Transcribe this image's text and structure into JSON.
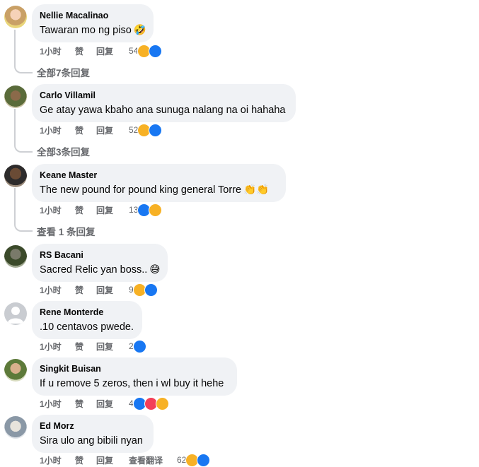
{
  "comments": [
    {
      "name": "Nellie Macalinao",
      "text": "Tawaran mo ng piso",
      "emoji": "🤣",
      "time": "1小时",
      "like": "赞",
      "reply": "回复",
      "count": "54",
      "reactions": [
        "haha",
        "like"
      ],
      "replies": "全部7条回复"
    },
    {
      "name": "Carlo Villamil",
      "text": "Ge atay yawa kbaho ana sunuga nalang na oi hahaha",
      "emoji": "",
      "time": "1小时",
      "like": "赞",
      "reply": "回复",
      "count": "52",
      "reactions": [
        "haha",
        "like"
      ],
      "replies": "全部3条回复"
    },
    {
      "name": "Keane Master",
      "text": "The new pound for pound king general Torre",
      "emoji": "👏👏",
      "time": "1小时",
      "like": "赞",
      "reply": "回复",
      "count": "13",
      "reactions": [
        "like",
        "haha"
      ],
      "replies": "查看 1 条回复"
    },
    {
      "name": "RS Bacani",
      "text": "Sacred Relic yan boss..",
      "emoji": "😅",
      "time": "1小时",
      "like": "赞",
      "reply": "回复",
      "count": "9",
      "reactions": [
        "haha",
        "like"
      ],
      "replies": ""
    },
    {
      "name": "Rene Monterde",
      "text": ".10 centavos pwede.",
      "emoji": "",
      "time": "1小时",
      "like": "赞",
      "reply": "回复",
      "count": "2",
      "reactions": [
        "like"
      ],
      "replies": ""
    },
    {
      "name": "Singkit Buisan",
      "text": "If u remove 5 zeros, then i wl buy it hehe",
      "emoji": "",
      "time": "1小时",
      "like": "赞",
      "reply": "回复",
      "count": "4",
      "reactions": [
        "like",
        "love",
        "haha"
      ],
      "replies": ""
    },
    {
      "name": "Ed Morz",
      "text": "Sira ulo ang bibili nyan",
      "emoji": "",
      "time": "1小时",
      "like": "赞",
      "reply": "回复",
      "translate": "查看翻译",
      "count": "62",
      "reactions": [
        "haha",
        "like"
      ],
      "replies": ""
    }
  ],
  "colors": {
    "bubble": "#f0f2f5",
    "meta": "#65676b",
    "like": "#1877f2",
    "haha": "#f7b125",
    "love": "#f33e58"
  }
}
